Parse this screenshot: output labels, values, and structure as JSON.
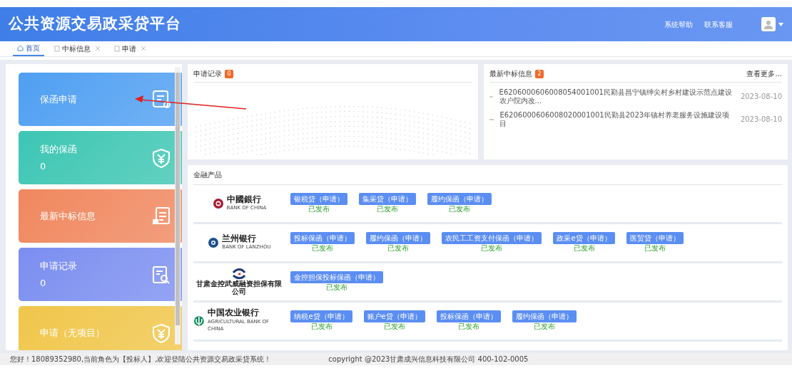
{
  "header": {
    "title": "公共资源交易政采贷平台",
    "links": [
      "系统帮助",
      "联系客服"
    ]
  },
  "tabs": [
    {
      "label": "首页",
      "selected": true,
      "closable": false
    },
    {
      "label": "中标信息",
      "selected": false,
      "closable": true
    },
    {
      "label": "申请",
      "selected": false,
      "closable": true
    }
  ],
  "tiles": [
    {
      "label": "保函申请",
      "color": "#4f9ff2",
      "kind": "form"
    },
    {
      "label": "我的保函",
      "count": "0",
      "color": "#3dc6b3",
      "kind": "shield"
    },
    {
      "label": "最新中标信息",
      "color": "#f0875e",
      "kind": "document"
    },
    {
      "label": "申请记录",
      "count": "0",
      "color": "#7b8ef0",
      "kind": "search"
    },
    {
      "label": "申请（无项目）",
      "color": "#f0c64a",
      "kind": "shield"
    }
  ],
  "records": {
    "title": "申请记录",
    "badge": "0"
  },
  "news": {
    "title": "最新中标信息",
    "badge": "2",
    "more": "查看更多...",
    "items": [
      {
        "text": "E6206000606008054001001民勤县昌宁镇绅尖村乡村建设示范点建设农户院内改...",
        "date": "2023-08-10"
      },
      {
        "text": "E6206000606008020001001民勤县2023年镇村养老服务设施建设项目",
        "date": "2023-08-10"
      }
    ]
  },
  "finance": {
    "title": "金融产品",
    "banks": [
      {
        "kind": "boc",
        "name": "中國銀行",
        "subname": "BANK OF CHINA",
        "products": [
          {
            "label": "银税贷（申请）",
            "status": "已发布"
          },
          {
            "label": "集采贷（申请）",
            "status": "已发布"
          },
          {
            "label": "履约保函（申请）",
            "status": "已发布"
          }
        ]
      },
      {
        "kind": "lzb",
        "name": "兰州银行",
        "subname": "BANK OF LANZHOU",
        "products": [
          {
            "label": "投标保函（申请）",
            "status": "已发布"
          },
          {
            "label": "履约保函（申请）",
            "status": "已发布"
          },
          {
            "label": "农民工工资支付保函（申请）",
            "status": "已发布"
          },
          {
            "label": "政采e贷（申请）",
            "status": "已发布"
          },
          {
            "label": "医贸贷（申请）",
            "status": "已发布"
          }
        ]
      },
      {
        "kind": "gsjk",
        "name": "甘肃金控武威融资担保有限公司",
        "products": [
          {
            "label": "金控担保投标保函（申请）",
            "status": "已发布"
          }
        ]
      },
      {
        "kind": "abc",
        "name": "中国农业银行",
        "subname": "AGRICULTURAL BANK OF CHINA",
        "products": [
          {
            "label": "纳税e贷（申请）",
            "status": "已发布"
          },
          {
            "label": "账户e贷（申请）",
            "status": "已发布"
          },
          {
            "label": "投标保函（申请）",
            "status": "已发布"
          },
          {
            "label": "履约保函（申请）",
            "status": "已发布"
          }
        ]
      }
    ]
  },
  "footer": {
    "welcome": "您好！18089352980,当前角色为【投标人】,欢迎登陆公共资源交易政采贷系统！",
    "copyright": "copyright @2023甘肃成兴信息科技有限公司 400-102-0005"
  }
}
